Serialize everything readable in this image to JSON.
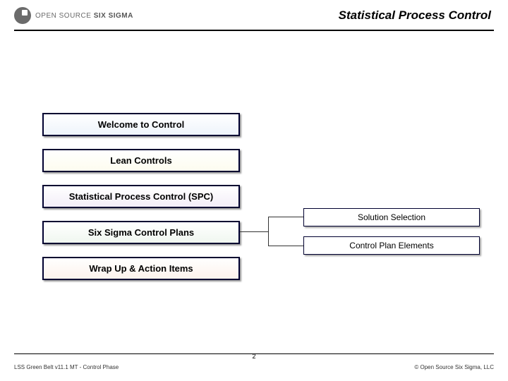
{
  "header": {
    "logo_main": "OPEN SOURCE",
    "logo_emph": "SIX SIGMA",
    "title": "Statistical Process Control"
  },
  "agenda": {
    "items": [
      {
        "label": "Welcome to Control"
      },
      {
        "label": "Lean Controls"
      },
      {
        "label": "Statistical Process Control (SPC)"
      },
      {
        "label": "Six Sigma Control Plans"
      },
      {
        "label": "Wrap Up & Action Items"
      }
    ],
    "detail_source_index": 3,
    "details": [
      {
        "label": "Solution Selection"
      },
      {
        "label": "Control Plan Elements"
      }
    ]
  },
  "footer": {
    "left": "LSS Green Belt v11.1 MT - Control Phase",
    "page": "2",
    "right": "©  Open Source Six Sigma, LLC"
  }
}
